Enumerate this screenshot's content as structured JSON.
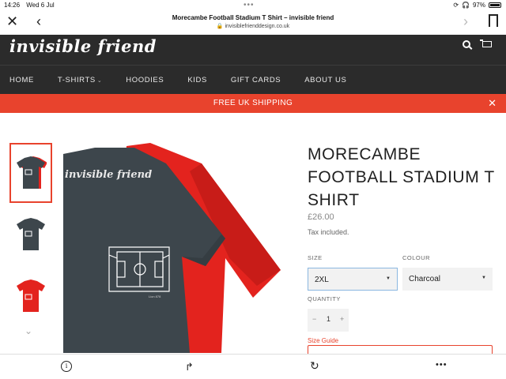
{
  "status_bar": {
    "time": "14:26",
    "date": "Wed 6 Jul",
    "battery": "97%",
    "battery_level": 0.97
  },
  "browser": {
    "page_title": "Morecambe Football Stadium T Shirt – invisible friend",
    "url": "invisiblefrienddesign.co.uk",
    "icons": [
      "close-icon",
      "back-icon",
      "forward-icon",
      "bookmark-icon",
      "lock-icon"
    ]
  },
  "site": {
    "logo": "invisible friend",
    "nav": [
      {
        "label": "HOME"
      },
      {
        "label": "T-SHIRTS",
        "has_dropdown": true
      },
      {
        "label": "HOODIES"
      },
      {
        "label": "KIDS"
      },
      {
        "label": "GIFT CARDS"
      },
      {
        "label": "ABOUT US"
      }
    ],
    "banner": "FREE UK SHIPPING",
    "header_bg": "#2b2b2b",
    "accent": "#e8432d"
  },
  "product": {
    "title": "MORECAMBE FOOTBALL STADIUM T SHIRT",
    "price": "£26.00",
    "tax_note": "Tax included.",
    "size_label": "SIZE",
    "size_value": "2XL",
    "colour_label": "COLOUR",
    "colour_value": "Charcoal",
    "quantity_label": "QUANTITY",
    "quantity_value": "1",
    "qty_minus": "−",
    "qty_plus": "+",
    "size_guide": "Size Guide",
    "image_logo_text": "invisible friend",
    "image_caption": "Lion 878",
    "thumbnails": [
      {
        "colour": "charcoal",
        "active": true
      },
      {
        "colour": "charcoal",
        "active": false
      },
      {
        "colour": "red",
        "active": false
      }
    ],
    "shirt_colors": {
      "charcoal": "#3d464c",
      "red": "#e3231e"
    }
  },
  "bottom_bar": {
    "icons": [
      "info-icon",
      "share-icon",
      "reload-icon",
      "more-icon"
    ]
  }
}
